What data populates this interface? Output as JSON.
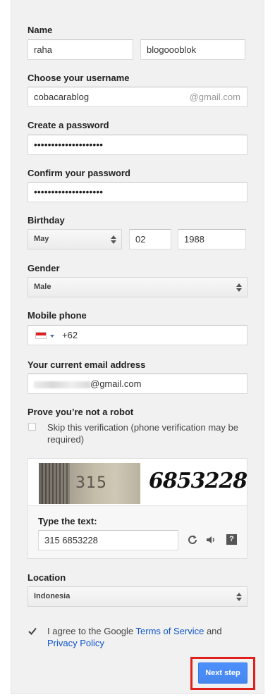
{
  "name": {
    "label": "Name",
    "first": "raha",
    "last": "blogoooblok"
  },
  "username": {
    "label": "Choose your username",
    "value": "cobacarablog",
    "suffix": "@gmail.com"
  },
  "password": {
    "label": "Create a password",
    "mask": "••••••••••••••••••••"
  },
  "confirm_password": {
    "label": "Confirm your password",
    "mask": "••••••••••••••••••••"
  },
  "birthday": {
    "label": "Birthday",
    "month": "May",
    "day": "02",
    "year": "1988"
  },
  "gender": {
    "label": "Gender",
    "value": "Male"
  },
  "mobile": {
    "label": "Mobile phone",
    "value": "+62",
    "flag_colors": [
      "#e02020",
      "#ffffff"
    ]
  },
  "current_email": {
    "label": "Your current email address",
    "value": "@gmail.com"
  },
  "robot": {
    "label": "Prove you’re not a robot",
    "skip_text": "Skip this verification (phone verification may be required)",
    "skip_checked": false
  },
  "captcha": {
    "image_text_1": "315",
    "image_text_2": "6853228",
    "type_label": "Type the text:",
    "value": "315 6853228",
    "refresh_icon": "refresh-icon",
    "audio_icon": "speaker-icon",
    "help_icon": "question-icon",
    "help_glyph": "?"
  },
  "location": {
    "label": "Location",
    "value": "Indonesia"
  },
  "terms": {
    "checked": true,
    "prefix": "I agree to the Google ",
    "tos_link": "Terms of Service",
    "and": " and",
    "privacy_link": "Privacy Policy"
  },
  "next_button": {
    "label": "Next step",
    "accent": "#4d90fe",
    "highlight": "#e0201a"
  }
}
